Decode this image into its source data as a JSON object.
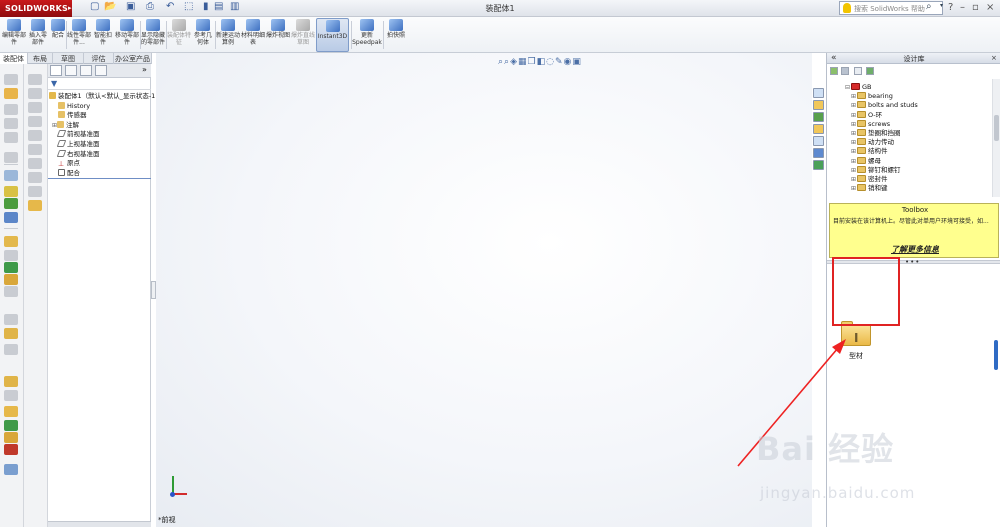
{
  "app": {
    "logo": "SOLIDWORKS",
    "window_title": "装配体1"
  },
  "search": {
    "placeholder": "搜索 SolidWorks 帮助"
  },
  "command_manager": [
    {
      "label": "编辑零部件",
      "state": "disabled"
    },
    {
      "label": "插入零部件",
      "state": "normal"
    },
    {
      "label": "配合",
      "state": "normal"
    },
    {
      "label": "线性零部件...",
      "state": "normal"
    },
    {
      "label": "智能扣件",
      "state": "normal"
    },
    {
      "label": "移动零部件",
      "state": "normal"
    },
    {
      "label": "显示隐藏的零部件",
      "state": "normal"
    },
    {
      "label": "装配体特征",
      "state": "disabled"
    },
    {
      "label": "参考几何体",
      "state": "normal"
    },
    {
      "label": "新建运动算例",
      "state": "normal"
    },
    {
      "label": "材料明细表",
      "state": "normal"
    },
    {
      "label": "爆炸视图",
      "state": "normal"
    },
    {
      "label": "爆炸直线草图",
      "state": "disabled"
    },
    {
      "label": "Instant3D",
      "state": "active"
    },
    {
      "label": "更新Speedpak",
      "state": "normal"
    },
    {
      "label": "拍快照",
      "state": "normal"
    }
  ],
  "tabs": [
    "装配体",
    "布局",
    "草图",
    "评估",
    "办公室产品"
  ],
  "feature_tree": [
    {
      "label": "装配体1（默认<默认_显示状态-1>）",
      "icon": "assembly-icon",
      "indent": 0
    },
    {
      "label": "History",
      "icon": "history-icon",
      "indent": 1
    },
    {
      "label": "传感器",
      "icon": "sensor-icon",
      "indent": 1
    },
    {
      "label": "注解",
      "icon": "annotation-icon",
      "indent": 1
    },
    {
      "label": "前视基准面",
      "icon": "plane-icon",
      "indent": 1
    },
    {
      "label": "上视基准面",
      "icon": "plane-icon",
      "indent": 1
    },
    {
      "label": "右视基准面",
      "icon": "plane-icon",
      "indent": 1
    },
    {
      "label": "原点",
      "icon": "origin-icon",
      "indent": 1
    },
    {
      "label": "配合",
      "icon": "mates-icon",
      "indent": 0
    }
  ],
  "graphics": {
    "view_label": "*前视"
  },
  "task_pane": {
    "title": "设计库",
    "tree": [
      {
        "label": "GB",
        "icon": "flag-icon",
        "indent": 0
      },
      {
        "label": "bearing",
        "indent": 1
      },
      {
        "label": "bolts and studs",
        "indent": 1
      },
      {
        "label": "O-环",
        "indent": 1
      },
      {
        "label": "screws",
        "indent": 1
      },
      {
        "label": "垫圈和挡圈",
        "indent": 1
      },
      {
        "label": "动力传动",
        "indent": 1
      },
      {
        "label": "结构件",
        "indent": 1
      },
      {
        "label": "螺母",
        "indent": 1
      },
      {
        "label": "铆钉和螺钉",
        "indent": 1
      },
      {
        "label": "密封件",
        "indent": 1
      },
      {
        "label": "销和键",
        "indent": 1
      }
    ],
    "toolbox": {
      "title": "Toolbox",
      "message": "目前安装在该计算机上。尽管此对单用户环境可接受，如...",
      "link": "了解更多信息"
    },
    "folder": {
      "label": "型材",
      "icon": "profile-folder-icon"
    }
  },
  "watermark": {
    "brand": "Bai 经验",
    "url": "jingyan.baidu.com"
  }
}
